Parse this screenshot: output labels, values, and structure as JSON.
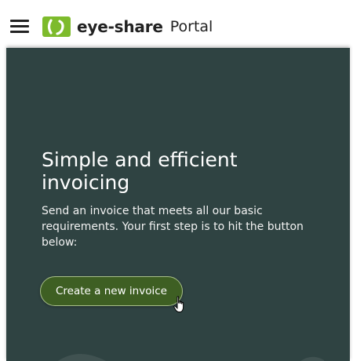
{
  "header": {
    "menu_icon": "hamburger-menu-icon",
    "logo_icon": "eye-share-logo-icon",
    "brand_name": "eye-share",
    "portal_label": "Portal",
    "brand_color": "#7dbb2c"
  },
  "hero": {
    "title": "Simple and efficient invoicing",
    "description": "Send an invoice that meets all our basic requirements. Your first step is to hit the button below:",
    "cta_label": "Create a new invoice",
    "background_color": "#2f4342",
    "button_color": "#3e5f23",
    "cursor_icon": "hand-pointer-cursor-icon"
  }
}
